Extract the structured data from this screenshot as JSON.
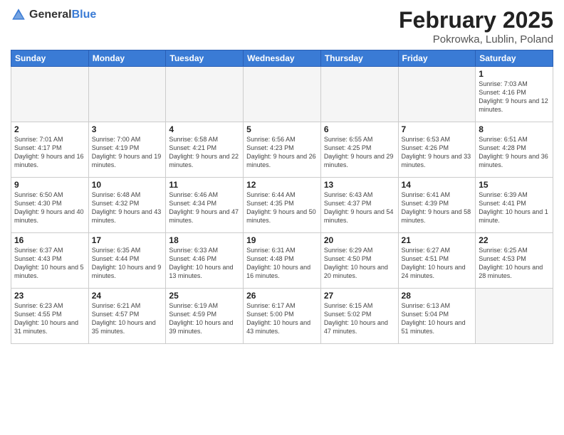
{
  "header": {
    "logo_general": "General",
    "logo_blue": "Blue",
    "month": "February 2025",
    "location": "Pokrowka, Lublin, Poland"
  },
  "weekdays": [
    "Sunday",
    "Monday",
    "Tuesday",
    "Wednesday",
    "Thursday",
    "Friday",
    "Saturday"
  ],
  "weeks": [
    [
      {
        "day": "",
        "info": ""
      },
      {
        "day": "",
        "info": ""
      },
      {
        "day": "",
        "info": ""
      },
      {
        "day": "",
        "info": ""
      },
      {
        "day": "",
        "info": ""
      },
      {
        "day": "",
        "info": ""
      },
      {
        "day": "1",
        "info": "Sunrise: 7:03 AM\nSunset: 4:16 PM\nDaylight: 9 hours and 12 minutes."
      }
    ],
    [
      {
        "day": "2",
        "info": "Sunrise: 7:01 AM\nSunset: 4:17 PM\nDaylight: 9 hours and 16 minutes."
      },
      {
        "day": "3",
        "info": "Sunrise: 7:00 AM\nSunset: 4:19 PM\nDaylight: 9 hours and 19 minutes."
      },
      {
        "day": "4",
        "info": "Sunrise: 6:58 AM\nSunset: 4:21 PM\nDaylight: 9 hours and 22 minutes."
      },
      {
        "day": "5",
        "info": "Sunrise: 6:56 AM\nSunset: 4:23 PM\nDaylight: 9 hours and 26 minutes."
      },
      {
        "day": "6",
        "info": "Sunrise: 6:55 AM\nSunset: 4:25 PM\nDaylight: 9 hours and 29 minutes."
      },
      {
        "day": "7",
        "info": "Sunrise: 6:53 AM\nSunset: 4:26 PM\nDaylight: 9 hours and 33 minutes."
      },
      {
        "day": "8",
        "info": "Sunrise: 6:51 AM\nSunset: 4:28 PM\nDaylight: 9 hours and 36 minutes."
      }
    ],
    [
      {
        "day": "9",
        "info": "Sunrise: 6:50 AM\nSunset: 4:30 PM\nDaylight: 9 hours and 40 minutes."
      },
      {
        "day": "10",
        "info": "Sunrise: 6:48 AM\nSunset: 4:32 PM\nDaylight: 9 hours and 43 minutes."
      },
      {
        "day": "11",
        "info": "Sunrise: 6:46 AM\nSunset: 4:34 PM\nDaylight: 9 hours and 47 minutes."
      },
      {
        "day": "12",
        "info": "Sunrise: 6:44 AM\nSunset: 4:35 PM\nDaylight: 9 hours and 50 minutes."
      },
      {
        "day": "13",
        "info": "Sunrise: 6:43 AM\nSunset: 4:37 PM\nDaylight: 9 hours and 54 minutes."
      },
      {
        "day": "14",
        "info": "Sunrise: 6:41 AM\nSunset: 4:39 PM\nDaylight: 9 hours and 58 minutes."
      },
      {
        "day": "15",
        "info": "Sunrise: 6:39 AM\nSunset: 4:41 PM\nDaylight: 10 hours and 1 minute."
      }
    ],
    [
      {
        "day": "16",
        "info": "Sunrise: 6:37 AM\nSunset: 4:43 PM\nDaylight: 10 hours and 5 minutes."
      },
      {
        "day": "17",
        "info": "Sunrise: 6:35 AM\nSunset: 4:44 PM\nDaylight: 10 hours and 9 minutes."
      },
      {
        "day": "18",
        "info": "Sunrise: 6:33 AM\nSunset: 4:46 PM\nDaylight: 10 hours and 13 minutes."
      },
      {
        "day": "19",
        "info": "Sunrise: 6:31 AM\nSunset: 4:48 PM\nDaylight: 10 hours and 16 minutes."
      },
      {
        "day": "20",
        "info": "Sunrise: 6:29 AM\nSunset: 4:50 PM\nDaylight: 10 hours and 20 minutes."
      },
      {
        "day": "21",
        "info": "Sunrise: 6:27 AM\nSunset: 4:51 PM\nDaylight: 10 hours and 24 minutes."
      },
      {
        "day": "22",
        "info": "Sunrise: 6:25 AM\nSunset: 4:53 PM\nDaylight: 10 hours and 28 minutes."
      }
    ],
    [
      {
        "day": "23",
        "info": "Sunrise: 6:23 AM\nSunset: 4:55 PM\nDaylight: 10 hours and 31 minutes."
      },
      {
        "day": "24",
        "info": "Sunrise: 6:21 AM\nSunset: 4:57 PM\nDaylight: 10 hours and 35 minutes."
      },
      {
        "day": "25",
        "info": "Sunrise: 6:19 AM\nSunset: 4:59 PM\nDaylight: 10 hours and 39 minutes."
      },
      {
        "day": "26",
        "info": "Sunrise: 6:17 AM\nSunset: 5:00 PM\nDaylight: 10 hours and 43 minutes."
      },
      {
        "day": "27",
        "info": "Sunrise: 6:15 AM\nSunset: 5:02 PM\nDaylight: 10 hours and 47 minutes."
      },
      {
        "day": "28",
        "info": "Sunrise: 6:13 AM\nSunset: 5:04 PM\nDaylight: 10 hours and 51 minutes."
      },
      {
        "day": "",
        "info": ""
      }
    ]
  ]
}
